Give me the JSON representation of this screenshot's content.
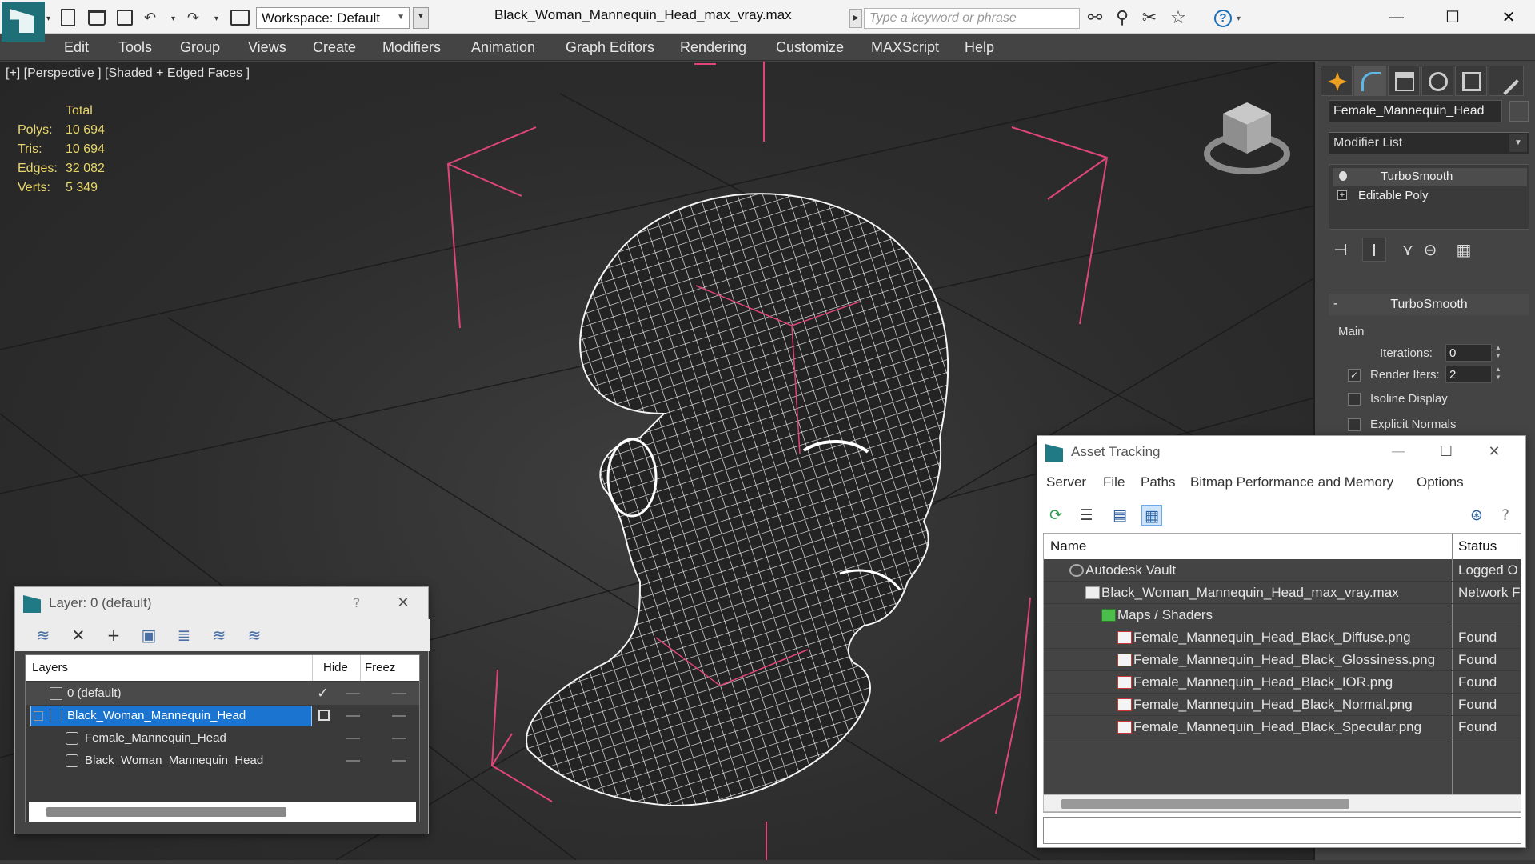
{
  "titlebar": {
    "workspace": "Workspace: Default",
    "file_title": "Black_Woman_Mannequin_Head_max_vray.max",
    "search_placeholder": "Type a keyword or phrase",
    "help": "?"
  },
  "menu": [
    "Edit",
    "Tools",
    "Group",
    "Views",
    "Create",
    "Modifiers",
    "Animation",
    "Graph Editors",
    "Rendering",
    "Customize",
    "MAXScript",
    "Help"
  ],
  "viewport": {
    "label": "[+] [Perspective ] [Shaded + Edged Faces ]",
    "stats": {
      "header": "Total",
      "rows": [
        {
          "label": "Polys:",
          "value": "10 694"
        },
        {
          "label": "Tris:",
          "value": "10 694"
        },
        {
          "label": "Edges:",
          "value": "32 082"
        },
        {
          "label": "Verts:",
          "value": "5 349"
        }
      ]
    },
    "colors": {
      "stats": "#e8d66a",
      "bbox": "#e0457a",
      "wire": "#ffffff"
    }
  },
  "command_panel": {
    "object_name": "Female_Mannequin_Head",
    "modifier_list": "Modifier List",
    "stack": [
      "TurboSmooth",
      "Editable Poly"
    ],
    "rollout": {
      "title": "TurboSmooth",
      "group": "Main",
      "iterations_label": "Iterations:",
      "iterations": "0",
      "render_iters_label": "Render Iters:",
      "render_iters": "2",
      "render_iters_checked": true,
      "isoline_label": "Isoline Display",
      "explicit_label": "Explicit Normals"
    }
  },
  "layer_dialog": {
    "title": "Layer: 0 (default)",
    "help": "?",
    "columns": {
      "layers": "Layers",
      "hide": "Hide",
      "freeze": "Freez"
    },
    "rows": [
      {
        "name": "0 (default)",
        "level": 0
      },
      {
        "name": "Black_Woman_Mannequin_Head",
        "level": 0
      },
      {
        "name": "Female_Mannequin_Head",
        "level": 1
      },
      {
        "name": "Black_Woman_Mannequin_Head",
        "level": 1
      }
    ]
  },
  "asset_dialog": {
    "title": "Asset Tracking",
    "menu": [
      "Server",
      "File",
      "Paths",
      "Bitmap Performance and Memory",
      "Options"
    ],
    "columns": {
      "name": "Name",
      "status": "Status"
    },
    "rows": [
      {
        "name": "Autodesk Vault",
        "status": "Logged O",
        "level": 0
      },
      {
        "name": "Black_Woman_Mannequin_Head_max_vray.max",
        "status": "Network F",
        "level": 1
      },
      {
        "name": "Maps / Shaders",
        "status": "",
        "level": 2
      },
      {
        "name": "Female_Mannequin_Head_Black_Diffuse.png",
        "status": "Found",
        "level": 3
      },
      {
        "name": "Female_Mannequin_Head_Black_Glossiness.png",
        "status": "Found",
        "level": 3
      },
      {
        "name": "Female_Mannequin_Head_Black_IOR.png",
        "status": "Found",
        "level": 3
      },
      {
        "name": "Female_Mannequin_Head_Black_Normal.png",
        "status": "Found",
        "level": 3
      },
      {
        "name": "Female_Mannequin_Head_Black_Specular.png",
        "status": "Found",
        "level": 3
      }
    ]
  }
}
